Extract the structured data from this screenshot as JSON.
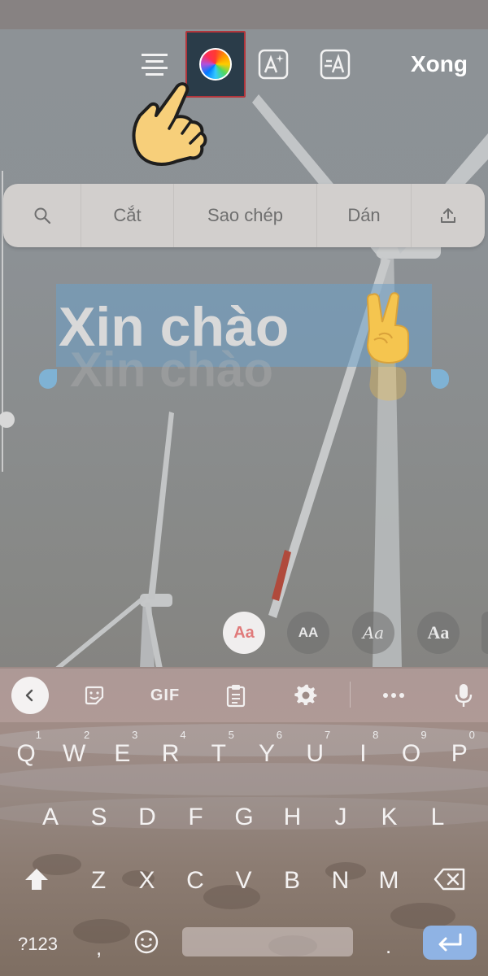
{
  "toolbar": {
    "done_label": "Xong",
    "icons": [
      "align-center-icon",
      "color-wheel-icon",
      "text-effects-icon",
      "font-icon"
    ]
  },
  "context_menu": {
    "cut": "Cắt",
    "copy": "Sao chép",
    "paste": "Dán"
  },
  "editor": {
    "text": "Xin chào"
  },
  "font_styles": [
    {
      "label": "Aa",
      "active": true
    },
    {
      "label": "AA",
      "active": false
    },
    {
      "label": "Aa",
      "active": false
    },
    {
      "label": "Aa",
      "active": false
    }
  ],
  "keyboard": {
    "toolbar": {
      "gif": "GIF"
    },
    "row1": [
      {
        "key": "Q",
        "num": "1"
      },
      {
        "key": "W",
        "num": "2"
      },
      {
        "key": "E",
        "num": "3"
      },
      {
        "key": "R",
        "num": "4"
      },
      {
        "key": "T",
        "num": "5"
      },
      {
        "key": "Y",
        "num": "6"
      },
      {
        "key": "U",
        "num": "7"
      },
      {
        "key": "I",
        "num": "8"
      },
      {
        "key": "O",
        "num": "9"
      },
      {
        "key": "P",
        "num": "0"
      }
    ],
    "row2": [
      "A",
      "S",
      "D",
      "F",
      "G",
      "H",
      "J",
      "K",
      "L"
    ],
    "row3": [
      "Z",
      "X",
      "C",
      "V",
      "B",
      "N",
      "M"
    ],
    "bottom": {
      "symbols": "?123",
      "comma": ",",
      "period": "."
    }
  },
  "colors": {
    "selected_button_bg": "#2a3c49",
    "selected_button_border": "#b2363c",
    "selection": "#6ea0c8",
    "enter_key": "#8fb3e4"
  }
}
